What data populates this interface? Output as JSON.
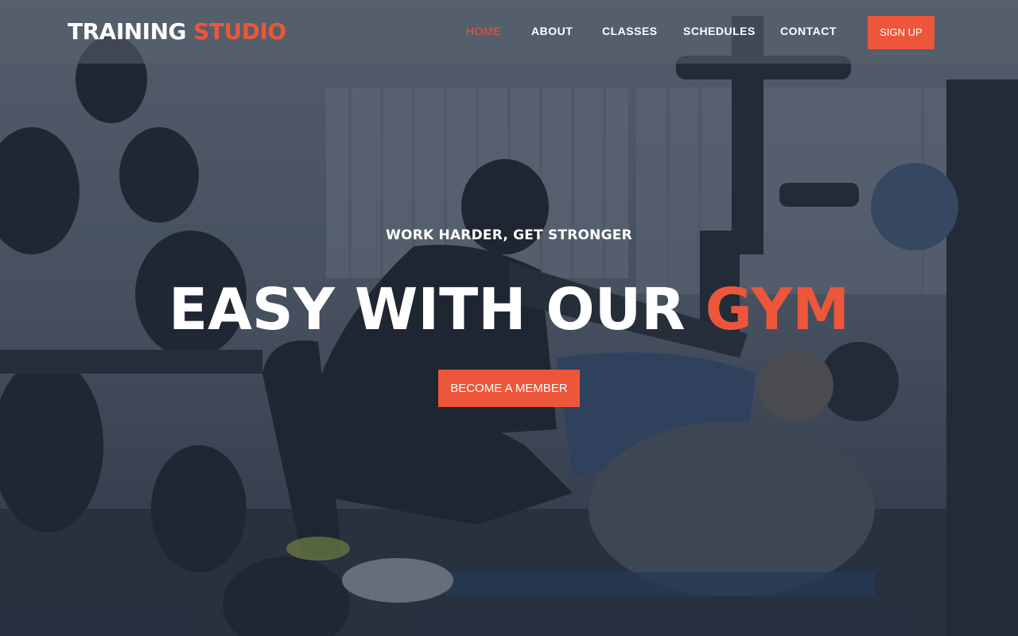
{
  "brand": {
    "part1": "TRAINING",
    "part2": "STUDIO"
  },
  "nav": {
    "items": [
      {
        "label": "HOME",
        "active": true
      },
      {
        "label": "ABOUT",
        "active": false
      },
      {
        "label": "CLASSES",
        "active": false
      },
      {
        "label": "SCHEDULES",
        "active": false
      },
      {
        "label": "CONTACT",
        "active": false
      }
    ],
    "signup_label": "SIGN UP"
  },
  "hero": {
    "subtitle": "WORK HARDER, GET STRONGER",
    "headline_main": "EASY WITH OUR ",
    "headline_accent": "GYM",
    "cta_label": "BECOME A MEMBER"
  },
  "colors": {
    "accent": "#ed563b",
    "text": "#ffffff",
    "overlay": "#232d3c"
  }
}
